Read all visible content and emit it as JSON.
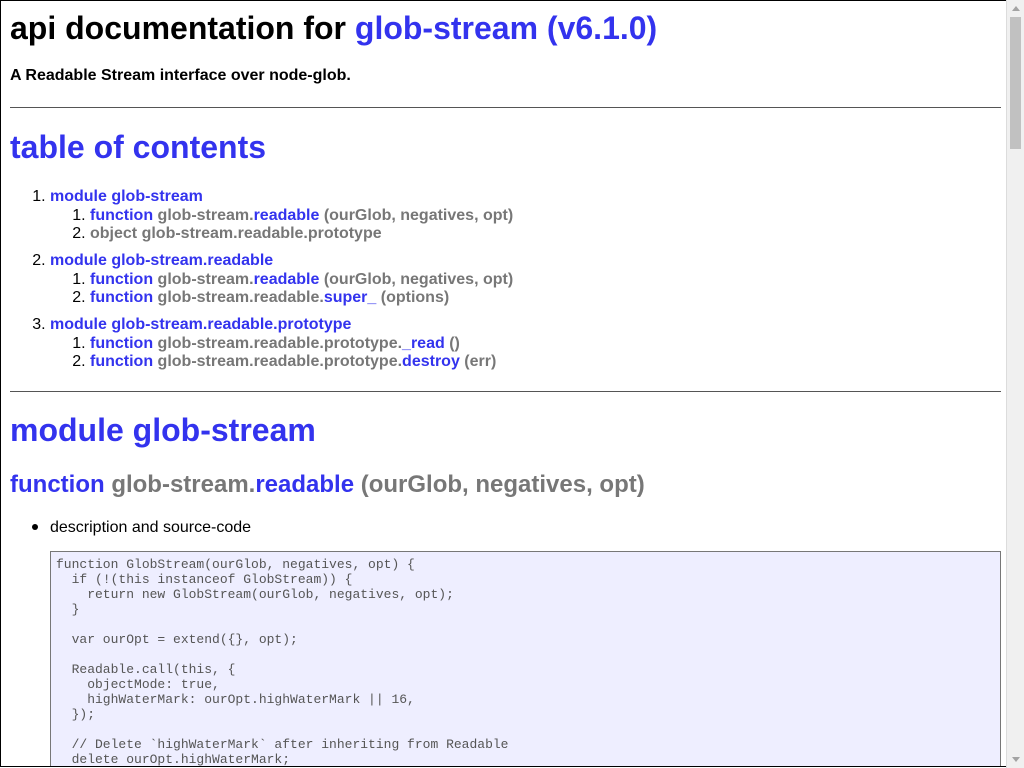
{
  "header": {
    "title_prefix": "api documentation for ",
    "title_link": "glob-stream (v6.1.0)",
    "subtitle": "A Readable Stream interface over node-glob."
  },
  "toc": {
    "title": "table of contents",
    "groups": [
      {
        "num": "1.",
        "label": "module glob-stream",
        "items": [
          {
            "num": "1.",
            "kind": "function",
            "prefix": "glob-stream.",
            "name": "readable",
            "args": "(ourGlob, negatives, opt)"
          },
          {
            "num": "2.",
            "kind": "object",
            "text": "glob-stream.readable.prototype"
          }
        ]
      },
      {
        "num": "2.",
        "label": "module glob-stream.readable",
        "items": [
          {
            "num": "1.",
            "kind": "function",
            "prefix": "glob-stream.",
            "name": "readable",
            "args": "(ourGlob, negatives, opt)"
          },
          {
            "num": "2.",
            "kind": "function",
            "prefix": "glob-stream.readable.",
            "name": "super_",
            "args": "(options)"
          }
        ]
      },
      {
        "num": "3.",
        "label": "module glob-stream.readable.prototype",
        "items": [
          {
            "num": "1.",
            "kind": "function",
            "prefix": "glob-stream.readable.prototype.",
            "name": "_read",
            "args": "()"
          },
          {
            "num": "2.",
            "kind": "function",
            "prefix": "glob-stream.readable.prototype.",
            "name": "destroy",
            "args": "(err)"
          }
        ]
      }
    ]
  },
  "section": {
    "module_title": "module glob-stream",
    "function_kind": "function",
    "function_prefix": "glob-stream.",
    "function_name": "readable",
    "function_args": "(ourGlob, negatives, opt)",
    "bullet": "description and source-code",
    "code": "function GlobStream(ourGlob, negatives, opt) {\n  if (!(this instanceof GlobStream)) {\n    return new GlobStream(ourGlob, negatives, opt);\n  }\n\n  var ourOpt = extend({}, opt);\n\n  Readable.call(this, {\n    objectMode: true,\n    highWaterMark: ourOpt.highWaterMark || 16,\n  });\n\n  // Delete `highWaterMark` after inheriting from Readable\n  delete ourOpt.highWaterMark;"
  },
  "colors": {
    "link": "#3333ee",
    "muted": "#777777",
    "code_bg": "#eeeeff"
  }
}
